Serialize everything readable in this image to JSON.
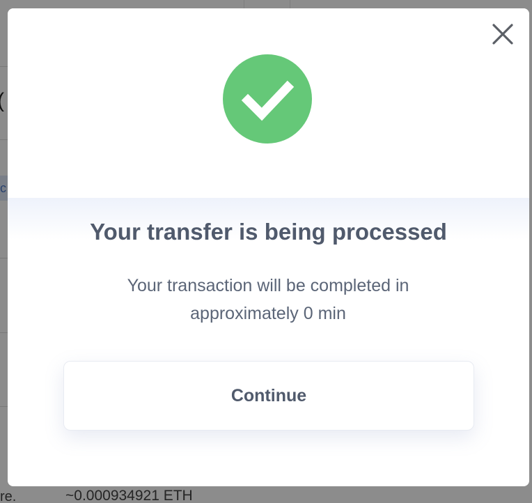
{
  "background": {
    "fragment_c": "(",
    "fragment_chip": "c",
    "fragment_left_text": "re.",
    "fragment_amount": "~0.000934921 ETH"
  },
  "modal": {
    "close_icon": "close-icon",
    "status_icon": "checkmark-circle-icon",
    "status_color": "#65c878",
    "title": "Your transfer is being processed",
    "message": "Your transaction will be completed in approximately 0 min",
    "continue_label": "Continue"
  }
}
